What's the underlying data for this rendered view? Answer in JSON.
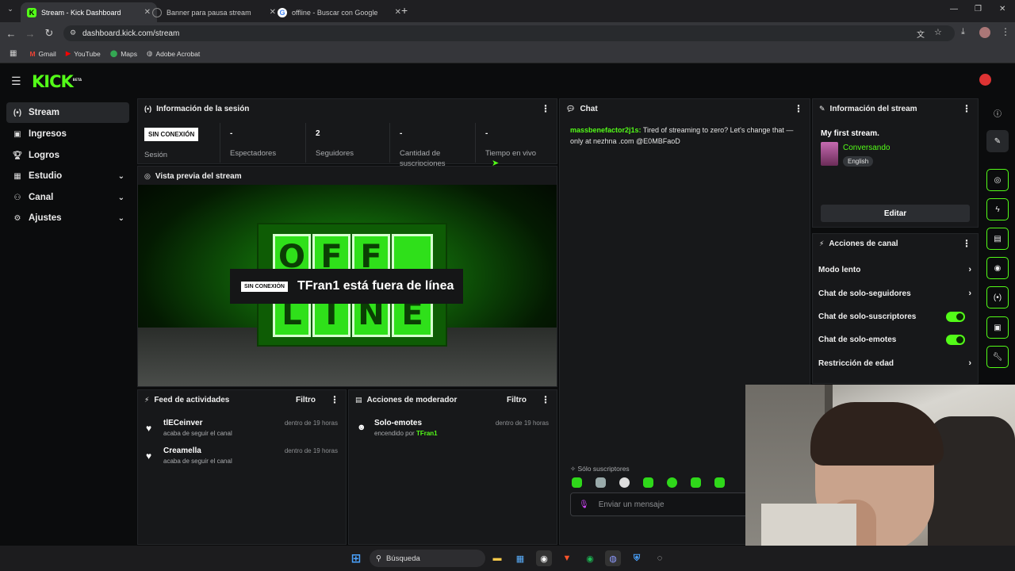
{
  "browser": {
    "tabs": [
      {
        "title": "Stream - Kick Dashboard",
        "active": true
      },
      {
        "title": "Banner para pausa stream",
        "active": false
      },
      {
        "title": "offline - Buscar con Google",
        "active": false
      }
    ],
    "url": "dashboard.kick.com/stream",
    "bookmarks": [
      "Gmail",
      "YouTube",
      "Maps",
      "Adobe Acrobat"
    ]
  },
  "brand": {
    "logo": "KICK",
    "beta": "BETA",
    "accent": "#53fc18"
  },
  "sidebar": {
    "items": [
      {
        "label": "Stream",
        "icon": "broadcast-icon",
        "active": true
      },
      {
        "label": "Ingresos",
        "icon": "money-icon"
      },
      {
        "label": "Logros",
        "icon": "trophy-icon"
      },
      {
        "label": "Estudio",
        "icon": "studio-icon",
        "expandable": true
      },
      {
        "label": "Canal",
        "icon": "users-icon",
        "expandable": true
      },
      {
        "label": "Ajustes",
        "icon": "gear-icon",
        "expandable": true
      }
    ]
  },
  "session": {
    "title": "Información de la sesión",
    "status_badge": "SIN CONEXIÓN",
    "stats": [
      {
        "value": "",
        "label": "Sesión"
      },
      {
        "value": "-",
        "label": "Espectadores"
      },
      {
        "value": "2",
        "label": "Seguidores"
      },
      {
        "value": "-",
        "label": "Cantidad de suscripciones"
      },
      {
        "value": "-",
        "label": "Tiempo en vivo"
      }
    ]
  },
  "preview": {
    "title": "Vista previa del stream",
    "badge": "SIN CONEXIÓN",
    "message": "TFran1 está fuera de línea",
    "letters": [
      "O",
      "F",
      "F",
      "",
      "L",
      "I",
      "N",
      "E"
    ]
  },
  "chat": {
    "title": "Chat",
    "messages": [
      {
        "user": "massbenefactor2j1s:",
        "text": " Tired of streaming to zero? Let's change that — only at nezhna .com @E0MBFaoD"
      }
    ],
    "mode_label": "Sólo suscriptores",
    "input_placeholder": "Enviar un mensaje"
  },
  "stream_info": {
    "title": "Información del stream",
    "stream_title": "My first stream.",
    "category": "Conversando",
    "language": "English",
    "edit_label": "Editar"
  },
  "channel_actions": {
    "title": "Acciones de canal",
    "items": [
      {
        "label": "Modo lento",
        "kind": "chevron"
      },
      {
        "label": "Chat de solo-seguidores",
        "kind": "chevron"
      },
      {
        "label": "Chat de solo-suscriptores",
        "kind": "toggle",
        "on": true
      },
      {
        "label": "Chat de solo-emotes",
        "kind": "toggle",
        "on": true
      },
      {
        "label": "Restricción de edad",
        "kind": "chevron"
      }
    ]
  },
  "activity": {
    "title": "Feed de actividades",
    "filter_label": "Filtro",
    "items": [
      {
        "name": "tlECeinver",
        "sub": "acaba de seguir el canal",
        "time": "dentro de 19 horas"
      },
      {
        "name": "Creamella",
        "sub": "acaba de seguir el canal",
        "time": "dentro de 19 horas"
      }
    ]
  },
  "moderator": {
    "title": "Acciones de moderador",
    "filter_label": "Filtro",
    "items": [
      {
        "name": "Solo-emotes",
        "sub_prefix": "encendido por",
        "sub_user": "TFran1",
        "time": "dentro de 19 horas"
      }
    ]
  },
  "taskbar": {
    "search_label": "Búsqueda"
  }
}
